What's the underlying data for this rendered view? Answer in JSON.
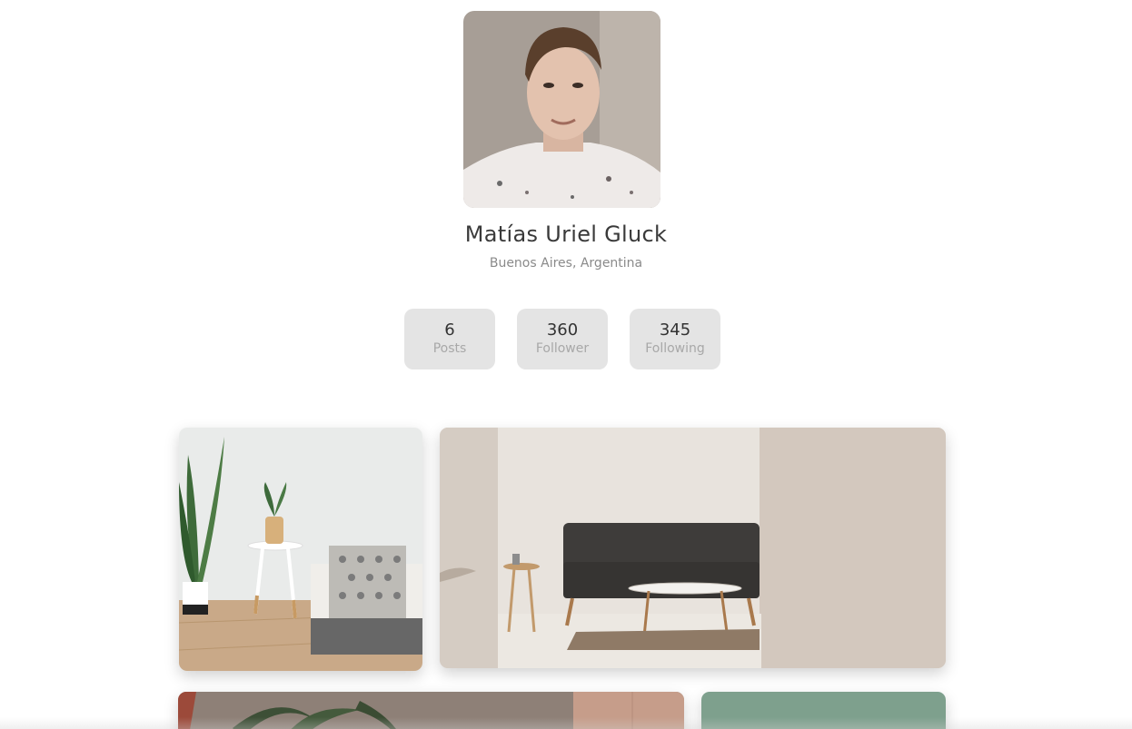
{
  "profile": {
    "name": "Matías Uriel Gluck",
    "location": "Buenos Aires, Argentina"
  },
  "stats": [
    {
      "value": "6",
      "label": "Posts"
    },
    {
      "value": "360",
      "label": "Follower"
    },
    {
      "value": "345",
      "label": "Following"
    }
  ],
  "colors": {
    "background": "#ffffff",
    "stat_card": "#e4e4e4",
    "name_text": "#3a3a3a",
    "secondary_text": "#8a8a8a"
  }
}
